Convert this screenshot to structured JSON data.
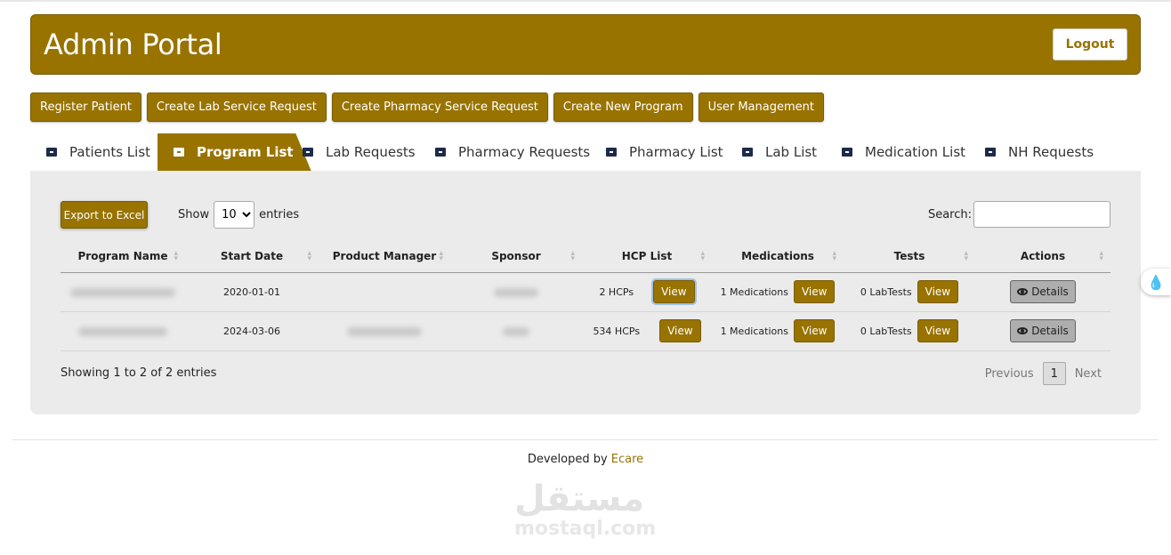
{
  "header": {
    "title": "Admin Portal",
    "logout_label": "Logout"
  },
  "action_buttons": [
    "Register Patient",
    "Create Lab Service Request",
    "Create Pharmacy Service Request",
    "Create New Program",
    "User Management"
  ],
  "tabs": [
    {
      "label": "Patients List",
      "active": false
    },
    {
      "label": "Program List",
      "active": true
    },
    {
      "label": "Lab Requests",
      "active": false
    },
    {
      "label": "Pharmacy Requests",
      "active": false
    },
    {
      "label": "Pharmacy List",
      "active": false
    },
    {
      "label": "Lab List",
      "active": false
    },
    {
      "label": "Medication List",
      "active": false
    },
    {
      "label": "NH Requests",
      "active": false
    }
  ],
  "toolbar": {
    "export_label": "Export to Excel",
    "show_label": "Show",
    "entries_value": "10",
    "entries_label": "entries",
    "search_label": "Search:",
    "search_value": ""
  },
  "table": {
    "columns": [
      "Program Name",
      "Start Date",
      "Product Manager",
      "Sponsor",
      "HCP List",
      "Medications",
      "Tests",
      "Actions"
    ],
    "rows": [
      {
        "start_date": "2020-01-01",
        "hcp": "2 HCPs",
        "medications": "1 Medications",
        "tests": "0 LabTests",
        "view_label": "View",
        "details_label": "Details"
      },
      {
        "start_date": "2024-03-06",
        "hcp": "534 HCPs",
        "medications": "1 Medications",
        "tests": "0 LabTests",
        "view_label": "View",
        "details_label": "Details"
      }
    ]
  },
  "pagination": {
    "info": "Showing 1 to 2 of 2 entries",
    "previous": "Previous",
    "current_page": "1",
    "next": "Next"
  },
  "footer": {
    "prefix": "Developed by ",
    "brand": "Ecare"
  },
  "watermark": {
    "arabic": "مستقل",
    "latin": "mostaql.com"
  },
  "colors": {
    "brand": "#987300",
    "panel": "#ebebeb",
    "details_button": "#aeaeae"
  },
  "icons": {
    "tab_icon": "ticket-icon",
    "details_icon": "eye-icon",
    "side_widget": "droplet-icon"
  }
}
